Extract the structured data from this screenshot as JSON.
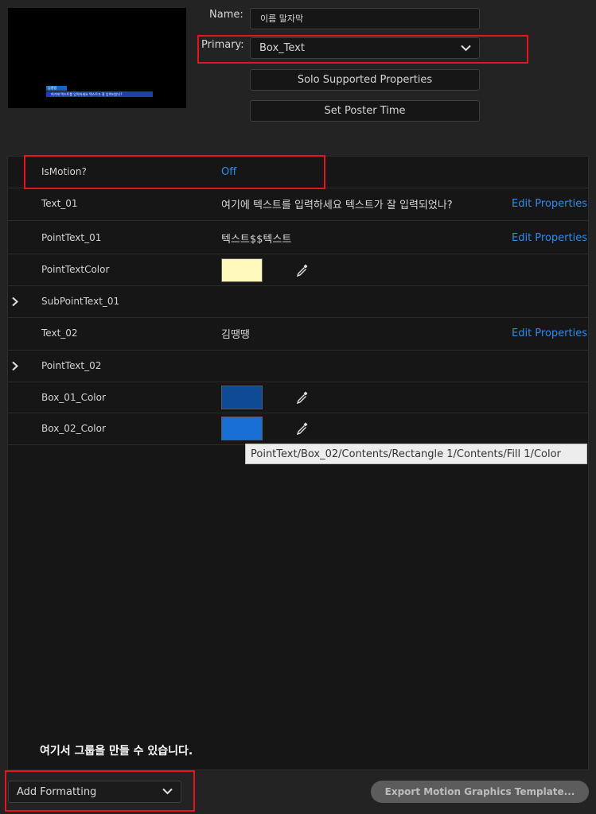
{
  "preview": {
    "caption_tag": "김땡땡",
    "caption_text": "여기에 텍스트를 입력하세요 텍스트가 잘 입력되었나?"
  },
  "header": {
    "name_label": "Name:",
    "name_value": "이름 말자막",
    "primary_label": "Primary:",
    "primary_value": "Box_Text",
    "solo_button": "Solo Supported Properties",
    "poster_button": "Set Poster Time"
  },
  "properties": [
    {
      "name": "IsMotion?",
      "value": "Off"
    },
    {
      "name": "Text_01",
      "value": "여기에 텍스트를 입력하세요 텍스트가 잘 입력되었나?",
      "edit": "Edit Properties"
    },
    {
      "name": "PointText_01",
      "value": "텍스트$$텍스트",
      "edit": "Edit Properties"
    },
    {
      "name": "PointTextColor",
      "color": "#fff9be"
    },
    {
      "name": "SubPointText_01"
    },
    {
      "name": "Text_02",
      "value": "김땡땡",
      "edit": "Edit Properties"
    },
    {
      "name": "PointText_02"
    },
    {
      "name": "Box_01_Color",
      "color": "#0f4a94"
    },
    {
      "name": "Box_02_Color",
      "color": "#1a6fd6"
    }
  ],
  "tooltip": "PointText/Box_02/Contents/Rectangle 1/Contents/Fill 1/Color",
  "note": "여기서 그룹을 만들 수 있습니다.",
  "footer": {
    "add_formatting": "Add Formatting",
    "export_button": "Export Motion Graphics Template..."
  },
  "colors": {
    "accent": "#2d8ceb",
    "highlight": "#e8131c",
    "background": "#232323",
    "panel": "#161616"
  }
}
